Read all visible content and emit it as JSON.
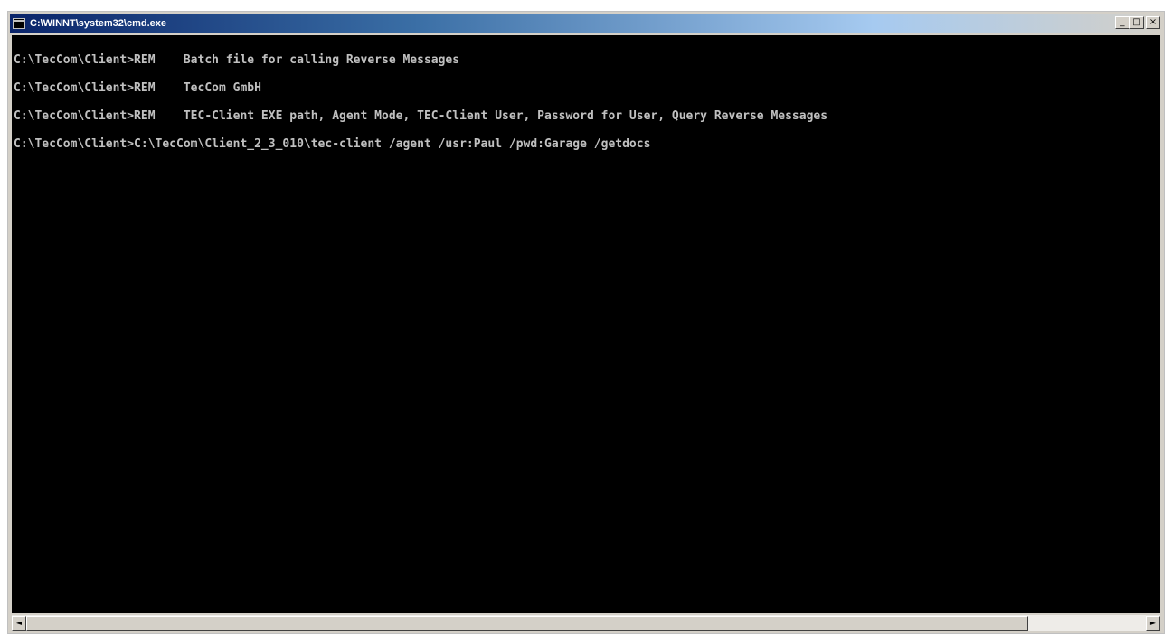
{
  "window": {
    "title": "C:\\WINNT\\system32\\cmd.exe",
    "icon": "cmd-icon",
    "buttons": {
      "minimize": "_",
      "maximize": "□",
      "close": "×"
    }
  },
  "console": {
    "lines": [
      "C:\\TecCom\\Client>REM    Batch file for calling Reverse Messages",
      "C:\\TecCom\\Client>REM    TecCom GmbH",
      "C:\\TecCom\\Client>REM    TEC-Client EXE path, Agent Mode, TEC-Client User, Password for User, Query Reverse Messages",
      "C:\\TecCom\\Client>C:\\TecCom\\Client_2_3_010\\tec-client /agent /usr:Paul /pwd:Garage /getdocs"
    ]
  },
  "scrollbar": {
    "left_arrow": "◄",
    "right_arrow": "►"
  },
  "colors": {
    "console_bg": "#000000",
    "console_text": "#c0c0c0",
    "titlebar_start": "#0a246a",
    "titlebar_end": "#a6caf0"
  }
}
